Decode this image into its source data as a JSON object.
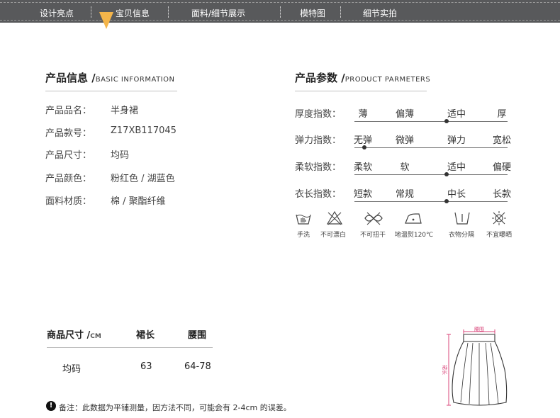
{
  "nav": {
    "items": [
      "设计亮点",
      "宝贝信息",
      "面料/细节展示",
      "模特图",
      "细节实拍"
    ],
    "active_index": 1,
    "accent_color": "#f4b54a",
    "bar_color": "#58595b"
  },
  "basic_info": {
    "title_cn": "产品信息",
    "title_en": "BASIC INFORMATION",
    "rows": [
      {
        "label": "产品品名：",
        "value": "半身裙"
      },
      {
        "label": "产品款号：",
        "value": "Z17XB117045"
      },
      {
        "label": "产品尺寸：",
        "value": "均码"
      },
      {
        "label": "产品颜色：",
        "value": "粉红色 / 湖蓝色"
      },
      {
        "label": "面料材质：",
        "value": "棉 / 聚酯纤维"
      }
    ]
  },
  "product_params": {
    "title_cn": "产品参数",
    "title_en": "PRODUCT PARMETERS",
    "rows": [
      {
        "label": "厚度指数：",
        "options": [
          "薄",
          "偏薄",
          "适中",
          "厚"
        ],
        "selected_index": 2
      },
      {
        "label": "弹力指数：",
        "options": [
          "无弹",
          "微弹",
          "弹力",
          "宽松"
        ],
        "selected_index": 0
      },
      {
        "label": "柔软指数：",
        "options": [
          "柔软",
          "软",
          "适中",
          "偏硬"
        ],
        "selected_index": 2
      },
      {
        "label": "衣长指数：",
        "options": [
          "短款",
          "常规",
          "中长",
          "长款"
        ],
        "selected_index": 2
      }
    ]
  },
  "care": [
    {
      "icon": "hand-wash-icon",
      "label": "手洗"
    },
    {
      "icon": "no-bleach-icon",
      "label": "不可漂白"
    },
    {
      "icon": "no-wring-icon",
      "label": "不可扭干"
    },
    {
      "icon": "low-iron-icon",
      "label": "地温熨120℃"
    },
    {
      "icon": "separate-wash-icon",
      "label": "衣物分隔"
    },
    {
      "icon": "no-sun-dry-icon",
      "label": "不宜曝晒"
    }
  ],
  "size_table": {
    "title_cn": "商品尺寸",
    "title_unit": "CM",
    "columns": [
      "裙长",
      "腰围"
    ],
    "rows": [
      {
        "size": "均码",
        "length": "63",
        "waist": "64-78"
      }
    ]
  },
  "diagram": {
    "waist_label": "腰围",
    "length_label": "裙长",
    "measure_color": "#d9457a"
  },
  "note": "备注：此数据为平铺测量，因方法不同，可能会有 2-4cm 的误差。"
}
